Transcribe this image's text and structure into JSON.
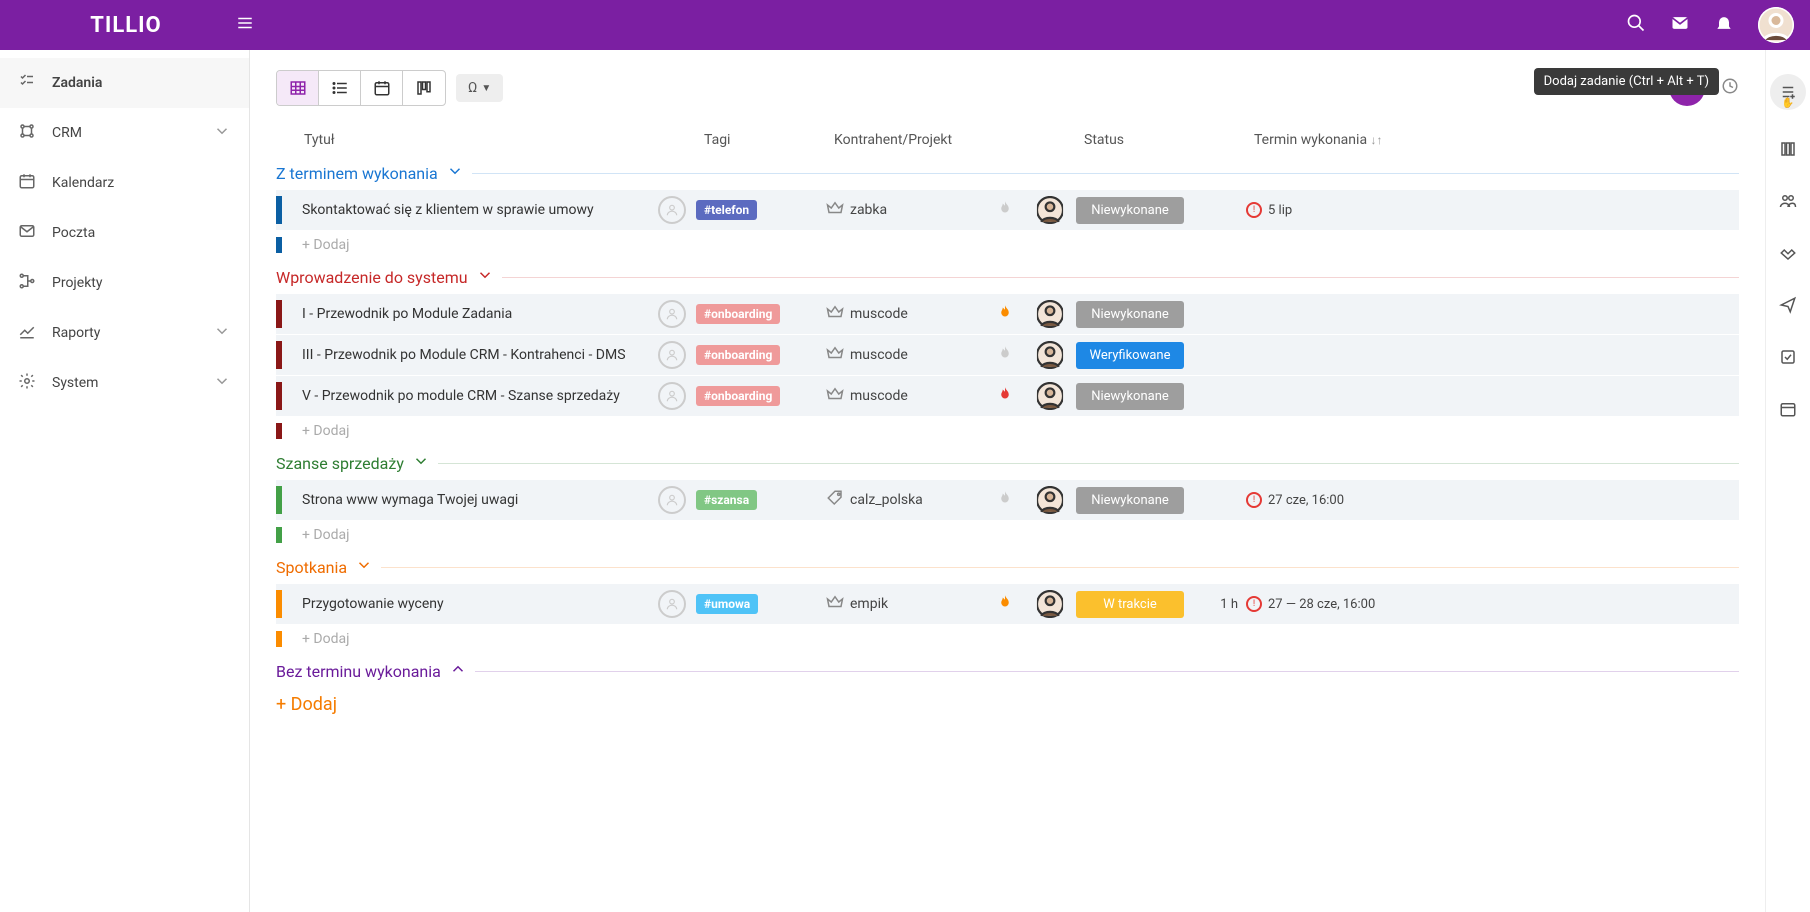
{
  "brand": "TILLIO",
  "topbarTooltip": "Dodaj zadanie (Ctrl + Alt + T)",
  "sidebar": [
    {
      "label": "Zadania",
      "active": true,
      "icon": "tasks",
      "chevron": false
    },
    {
      "label": "CRM",
      "icon": "crm",
      "chevron": true
    },
    {
      "label": "Kalendarz",
      "icon": "calendar",
      "chevron": false
    },
    {
      "label": "Poczta",
      "icon": "mail",
      "chevron": false
    },
    {
      "label": "Projekty",
      "icon": "projects",
      "chevron": false
    },
    {
      "label": "Raporty",
      "icon": "reports",
      "chevron": true
    },
    {
      "label": "System",
      "icon": "settings",
      "chevron": true
    }
  ],
  "filterLabel": "Ω",
  "columns": {
    "title": "Tytuł",
    "tags": "Tagi",
    "contractor": "Kontrahent/Projekt",
    "status": "Status",
    "due": "Termin wykonania"
  },
  "addLabel": "+ Dodaj",
  "groups": [
    {
      "title": "Z terminem wykonania",
      "color": "#1976d2",
      "barColor": "#0b5fa3",
      "chevron": "down",
      "rows": [
        {
          "title": "Skontaktować się z klientem w sprawie umowy",
          "tag": {
            "text": "#telefon",
            "bg": "#5c6bc0"
          },
          "contractor": {
            "name": "zabka",
            "icon": "crown"
          },
          "fire": "gray",
          "status": {
            "text": "Niewykonane",
            "bg": "#9e9e9e"
          },
          "dueWarn": true,
          "due": "5 lip"
        }
      ]
    },
    {
      "title": "Wprowadzenie do systemu",
      "color": "#c62828",
      "barColor": "#8a1717",
      "chevron": "down",
      "rows": [
        {
          "title": "I - Przewodnik po Module Zadania",
          "tag": {
            "text": "#onboarding",
            "bg": "#ef9a9a"
          },
          "contractor": {
            "name": "muscode",
            "icon": "crown"
          },
          "fire": "orange",
          "status": {
            "text": "Niewykonane",
            "bg": "#9e9e9e"
          }
        },
        {
          "title": "III - Przewodnik po Module CRM - Kontrahenci - DMS",
          "tag": {
            "text": "#onboarding",
            "bg": "#ef9a9a"
          },
          "contractor": {
            "name": "muscode",
            "icon": "crown"
          },
          "fire": "gray",
          "status": {
            "text": "Weryfikowane",
            "bg": "#1e88e5"
          }
        },
        {
          "title": "V - Przewodnik po module CRM - Szanse sprzedaży",
          "tag": {
            "text": "#onboarding",
            "bg": "#ef9a9a"
          },
          "contractor": {
            "name": "muscode",
            "icon": "crown"
          },
          "fire": "red",
          "status": {
            "text": "Niewykonane",
            "bg": "#9e9e9e"
          }
        }
      ]
    },
    {
      "title": "Szanse sprzedaży",
      "color": "#2e7d32",
      "barColor": "#43a047",
      "chevron": "down",
      "rows": [
        {
          "title": "Strona www wymaga Twojej uwagi",
          "tag": {
            "text": "#szansa",
            "bg": "#81c784"
          },
          "contractor": {
            "name": "calz_polska",
            "icon": "tag"
          },
          "fire": "gray",
          "status": {
            "text": "Niewykonane",
            "bg": "#9e9e9e"
          },
          "dueWarn": true,
          "due": "27 cze, 16:00"
        }
      ]
    },
    {
      "title": "Spotkania",
      "color": "#ef6c00",
      "barColor": "#fb8c00",
      "chevron": "down",
      "rows": [
        {
          "title": "Przygotowanie wyceny",
          "tag": {
            "text": "#umowa",
            "bg": "#4fc3f7"
          },
          "contractor": {
            "name": "empik",
            "icon": "crown"
          },
          "fire": "orange",
          "status": {
            "text": "W trakcie",
            "bg": "#fbc02d"
          },
          "hours": "1 h",
          "dueWarn": true,
          "due": "27 — 28 cze, 16:00"
        }
      ]
    },
    {
      "title": "Bez terminu wykonania",
      "color": "#6a1b9a",
      "chevron": "up",
      "collapsed": true
    }
  ]
}
